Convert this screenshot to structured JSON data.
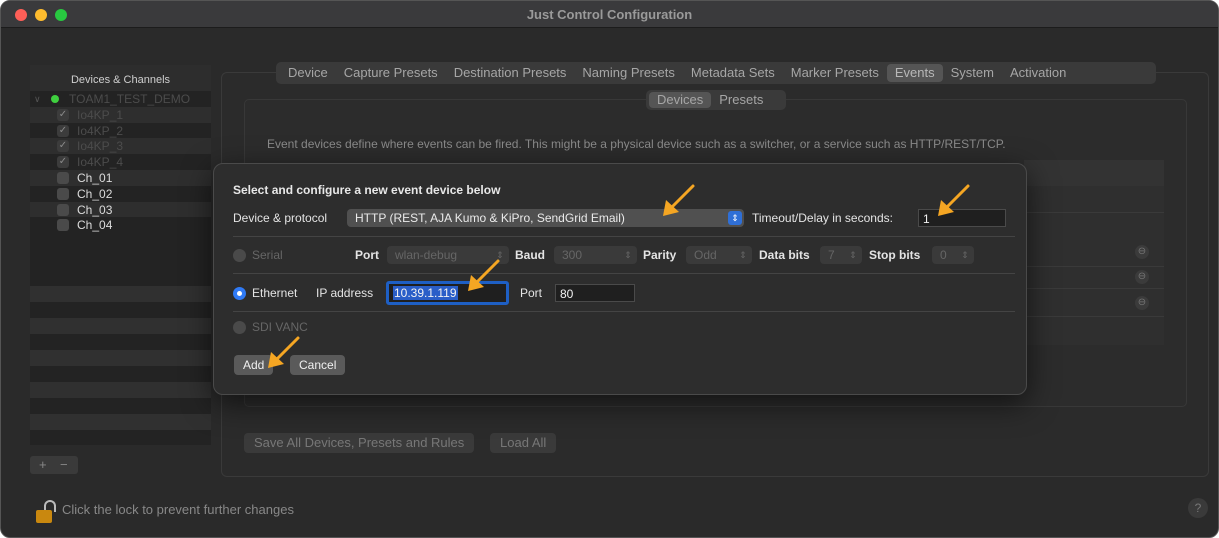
{
  "window": {
    "title": "Just Control Configuration"
  },
  "sidebar": {
    "header": "Devices & Channels",
    "root": "TOAM1_TEST_DEMO",
    "items": [
      {
        "label": "Io4KP_1",
        "checked": true,
        "dim": true
      },
      {
        "label": "Io4KP_2",
        "checked": true,
        "dim": true
      },
      {
        "label": "Io4KP_3",
        "checked": true,
        "dim": true
      },
      {
        "label": "Io4KP_4",
        "checked": true,
        "dim": true
      },
      {
        "label": "Ch_01",
        "checked": false,
        "dim": false
      },
      {
        "label": "Ch_02",
        "checked": false,
        "dim": false
      },
      {
        "label": "Ch_03",
        "checked": false,
        "dim": false
      },
      {
        "label": "Ch_04",
        "checked": false,
        "dim": false
      }
    ],
    "add_label": "+",
    "remove_label": "−"
  },
  "tabs": [
    "Device",
    "Capture Presets",
    "Destination Presets",
    "Naming Presets",
    "Metadata Sets",
    "Marker Presets",
    "Events",
    "System",
    "Activation"
  ],
  "active_tab": "Events",
  "subtabs": [
    "Devices",
    "Presets"
  ],
  "active_subtab": "Devices",
  "events": {
    "description": "Event devices define where events can be fired. This might be a physical device such as a switcher, or a service such as HTTP/REST/TCP.",
    "save_all_label": "Save All Devices, Presets and Rules",
    "load_all_label": "Load All"
  },
  "lock_text": "Click the lock to prevent further changes",
  "help_label": "?",
  "dialog": {
    "heading": "Select and configure a new event device below",
    "device_protocol_label": "Device & protocol",
    "device_protocol_value": "HTTP (REST, AJA Kumo & KiPro, SendGrid Email)",
    "timeout_label": "Timeout/Delay in seconds:",
    "timeout_value": "1",
    "serial": {
      "label": "Serial",
      "port_label": "Port",
      "port_value": "wlan-debug",
      "baud_label": "Baud",
      "baud_value": "300",
      "parity_label": "Parity",
      "parity_value": "Odd",
      "databits_label": "Data bits",
      "databits_value": "7",
      "stopbits_label": "Stop bits",
      "stopbits_value": "0"
    },
    "ethernet": {
      "label": "Ethernet",
      "ip_label": "IP address",
      "ip_value": "10.39.1.119",
      "port_label": "Port",
      "port_value": "80"
    },
    "sdi_label": "SDI VANC",
    "add_label": "Add",
    "cancel_label": "Cancel",
    "selected_connection": "Ethernet"
  },
  "colors": {
    "accent": "#2f7af5",
    "annotation_arrow": "#f5a623",
    "lock_body": "#c9880f"
  }
}
